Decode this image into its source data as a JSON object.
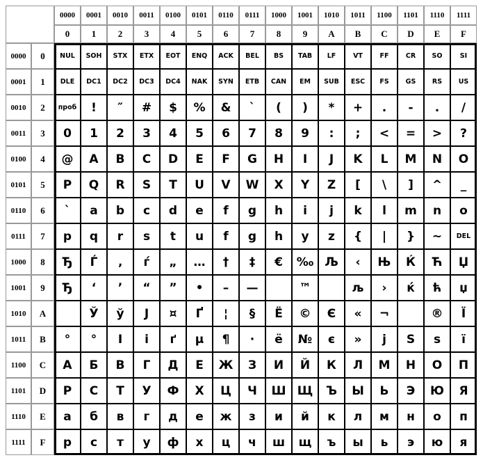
{
  "column_headers": {
    "binary": [
      "0000",
      "0001",
      "0010",
      "0011",
      "0100",
      "0101",
      "0110",
      "0111",
      "1000",
      "1001",
      "1010",
      "1011",
      "1100",
      "1101",
      "1110",
      "1111"
    ],
    "hex": [
      "0",
      "1",
      "2",
      "3",
      "4",
      "5",
      "6",
      "7",
      "8",
      "9",
      "A",
      "B",
      "C",
      "D",
      "E",
      "F"
    ]
  },
  "row_headers": {
    "binary": [
      "0000",
      "0001",
      "0010",
      "0011",
      "0100",
      "0101",
      "0110",
      "0111",
      "1000",
      "1001",
      "1010",
      "1011",
      "1100",
      "1101",
      "1110",
      "1111"
    ],
    "hex": [
      "0",
      "1",
      "2",
      "3",
      "4",
      "5",
      "6",
      "7",
      "8",
      "9",
      "A",
      "B",
      "C",
      "D",
      "E",
      "F"
    ]
  },
  "rows": [
    [
      "NUL",
      "SOH",
      "STX",
      "ETX",
      "EOT",
      "ENQ",
      "ACK",
      "BEL",
      "BS",
      "TAB",
      "LF",
      "VT",
      "FF",
      "CR",
      "SO",
      "SI"
    ],
    [
      "DLE",
      "DC1",
      "DC2",
      "DC3",
      "DC4",
      "NAK",
      "SYN",
      "ETB",
      "CAN",
      "EM",
      "SUB",
      "ESC",
      "FS",
      "GS",
      "RS",
      "US"
    ],
    [
      "проб",
      "!",
      "″",
      "#",
      "$",
      "%",
      "&",
      "`",
      "(",
      ")",
      "*",
      "+",
      ".",
      "-",
      ".",
      "/"
    ],
    [
      "0",
      "1",
      "2",
      "3",
      "4",
      "5",
      "6",
      "7",
      "8",
      "9",
      ":",
      ";",
      "<",
      "=",
      ">",
      "?"
    ],
    [
      "@",
      "A",
      "B",
      "C",
      "D",
      "E",
      "F",
      "G",
      "H",
      "I",
      "J",
      "K",
      "L",
      "M",
      "N",
      "O"
    ],
    [
      "P",
      "Q",
      "R",
      "S",
      "T",
      "U",
      "V",
      "W",
      "X",
      "Y",
      "Z",
      "[",
      "\\",
      "]",
      "^",
      "_"
    ],
    [
      "`",
      "a",
      "b",
      "c",
      "d",
      "e",
      "f",
      "g",
      "h",
      "i",
      "j",
      "k",
      "l",
      "m",
      "n",
      "o"
    ],
    [
      "p",
      "q",
      "r",
      "s",
      "t",
      "u",
      "f",
      "g",
      "h",
      "y",
      "z",
      "{",
      "|",
      "}",
      "~",
      "DEL"
    ],
    [
      "Ђ",
      "Ѓ",
      "‚",
      "ѓ",
      "„",
      "…",
      "†",
      "‡",
      "€",
      "‰",
      "Љ",
      "‹",
      "Њ",
      "Ќ",
      "Ћ",
      "Џ"
    ],
    [
      "Ђ",
      "‘",
      "’",
      "“",
      "”",
      "•",
      "–",
      "—",
      "",
      "™",
      "",
      "љ",
      "›",
      "ќ",
      "ћ",
      "џ"
    ],
    [
      "",
      "Ў",
      "ў",
      "Ј",
      "¤",
      "Ґ",
      "¦",
      "§",
      "Ё",
      "©",
      "Є",
      "«",
      "¬",
      "",
      "®",
      "Ї"
    ],
    [
      "°",
      "°",
      "І",
      "і",
      "ґ",
      "µ",
      "¶",
      "·",
      "ё",
      "№",
      "є",
      "»",
      "ј",
      "Ѕ",
      "ѕ",
      "ї"
    ],
    [
      "А",
      "Б",
      "В",
      "Г",
      "Д",
      "Е",
      "Ж",
      "З",
      "И",
      "Й",
      "К",
      "Л",
      "М",
      "Н",
      "О",
      "П"
    ],
    [
      "Р",
      "С",
      "Т",
      "У",
      "Ф",
      "Х",
      "Ц",
      "Ч",
      "Ш",
      "Щ",
      "Ъ",
      "Ы",
      "Ь",
      "Э",
      "Ю",
      "Я"
    ],
    [
      "а",
      "б",
      "в",
      "г",
      "д",
      "е",
      "ж",
      "з",
      "и",
      "й",
      "к",
      "л",
      "м",
      "н",
      "о",
      "п"
    ],
    [
      "р",
      "с",
      "т",
      "у",
      "ф",
      "х",
      "ц",
      "ч",
      "ш",
      "щ",
      "ъ",
      "ы",
      "ь",
      "э",
      "ю",
      "я"
    ]
  ]
}
